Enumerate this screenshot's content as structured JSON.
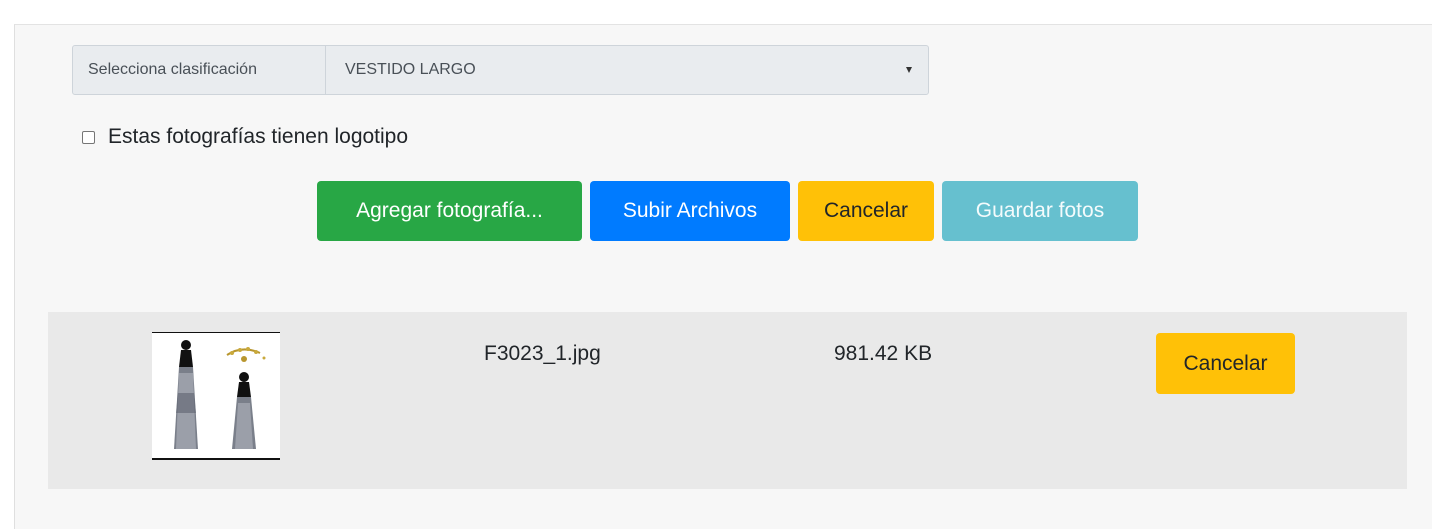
{
  "classification": {
    "prefix_label": "Selecciona clasificación",
    "selected_value": "VESTIDO LARGO"
  },
  "logo_checkbox": {
    "label": "Estas fotografías tienen logotipo",
    "checked": false
  },
  "actions": {
    "add_photo_label": "Agregar fotografía...",
    "upload_label": "Subir Archivos",
    "cancel_label": "Cancelar",
    "save_label": "Guardar fotos"
  },
  "files": [
    {
      "name": "F3023_1.jpg",
      "size": "981.42 KB",
      "cancel_label": "Cancelar",
      "thumbnail_icon": "dress-photo-thumbnail"
    }
  ],
  "colors": {
    "success": "#28a745",
    "primary": "#007bff",
    "warning": "#ffc107",
    "info": "#66c0cf"
  }
}
